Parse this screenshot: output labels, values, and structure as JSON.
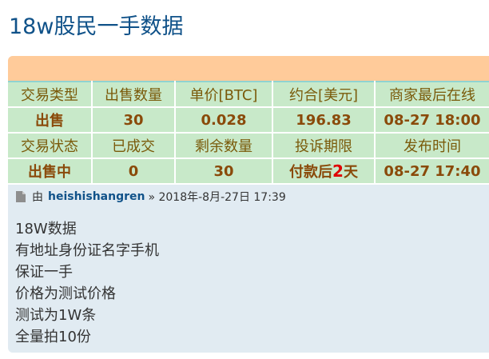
{
  "page": {
    "title": "18w股民一手数据"
  },
  "table": {
    "row1_headers": [
      "交易类型",
      "出售数量",
      "单价[BTC]",
      "约合[美元]",
      "商家最后在线"
    ],
    "row2_values": [
      "出售",
      "30",
      "0.028",
      "196.83",
      "08-27 18:00"
    ],
    "row3_headers": [
      "交易状态",
      "已成交",
      "剩余数量",
      "投诉期限",
      "发布时间"
    ],
    "row4_values": {
      "status": "出售中",
      "sold": "0",
      "remaining": "30",
      "complaint_prefix": "付款后",
      "complaint_days": "2",
      "complaint_suffix": "天",
      "publish_time": "08-27 17:40"
    }
  },
  "post": {
    "by_label": "由",
    "author": "heishishangren",
    "date": "» 2018年-8月-27日 17:39",
    "lines": [
      "18W数据",
      "有地址身份证名字手机",
      "保证一手",
      "价格为测试价格",
      "测试为1W条",
      "全量拍10份"
    ]
  },
  "colors": {
    "title": "#105289",
    "orange_bar": "#ffcb9a",
    "table_bg": "#c8e9c9",
    "post_bg": "#e1ebf2",
    "highlight": "#e00000"
  },
  "icons": {
    "post": "document-icon"
  }
}
